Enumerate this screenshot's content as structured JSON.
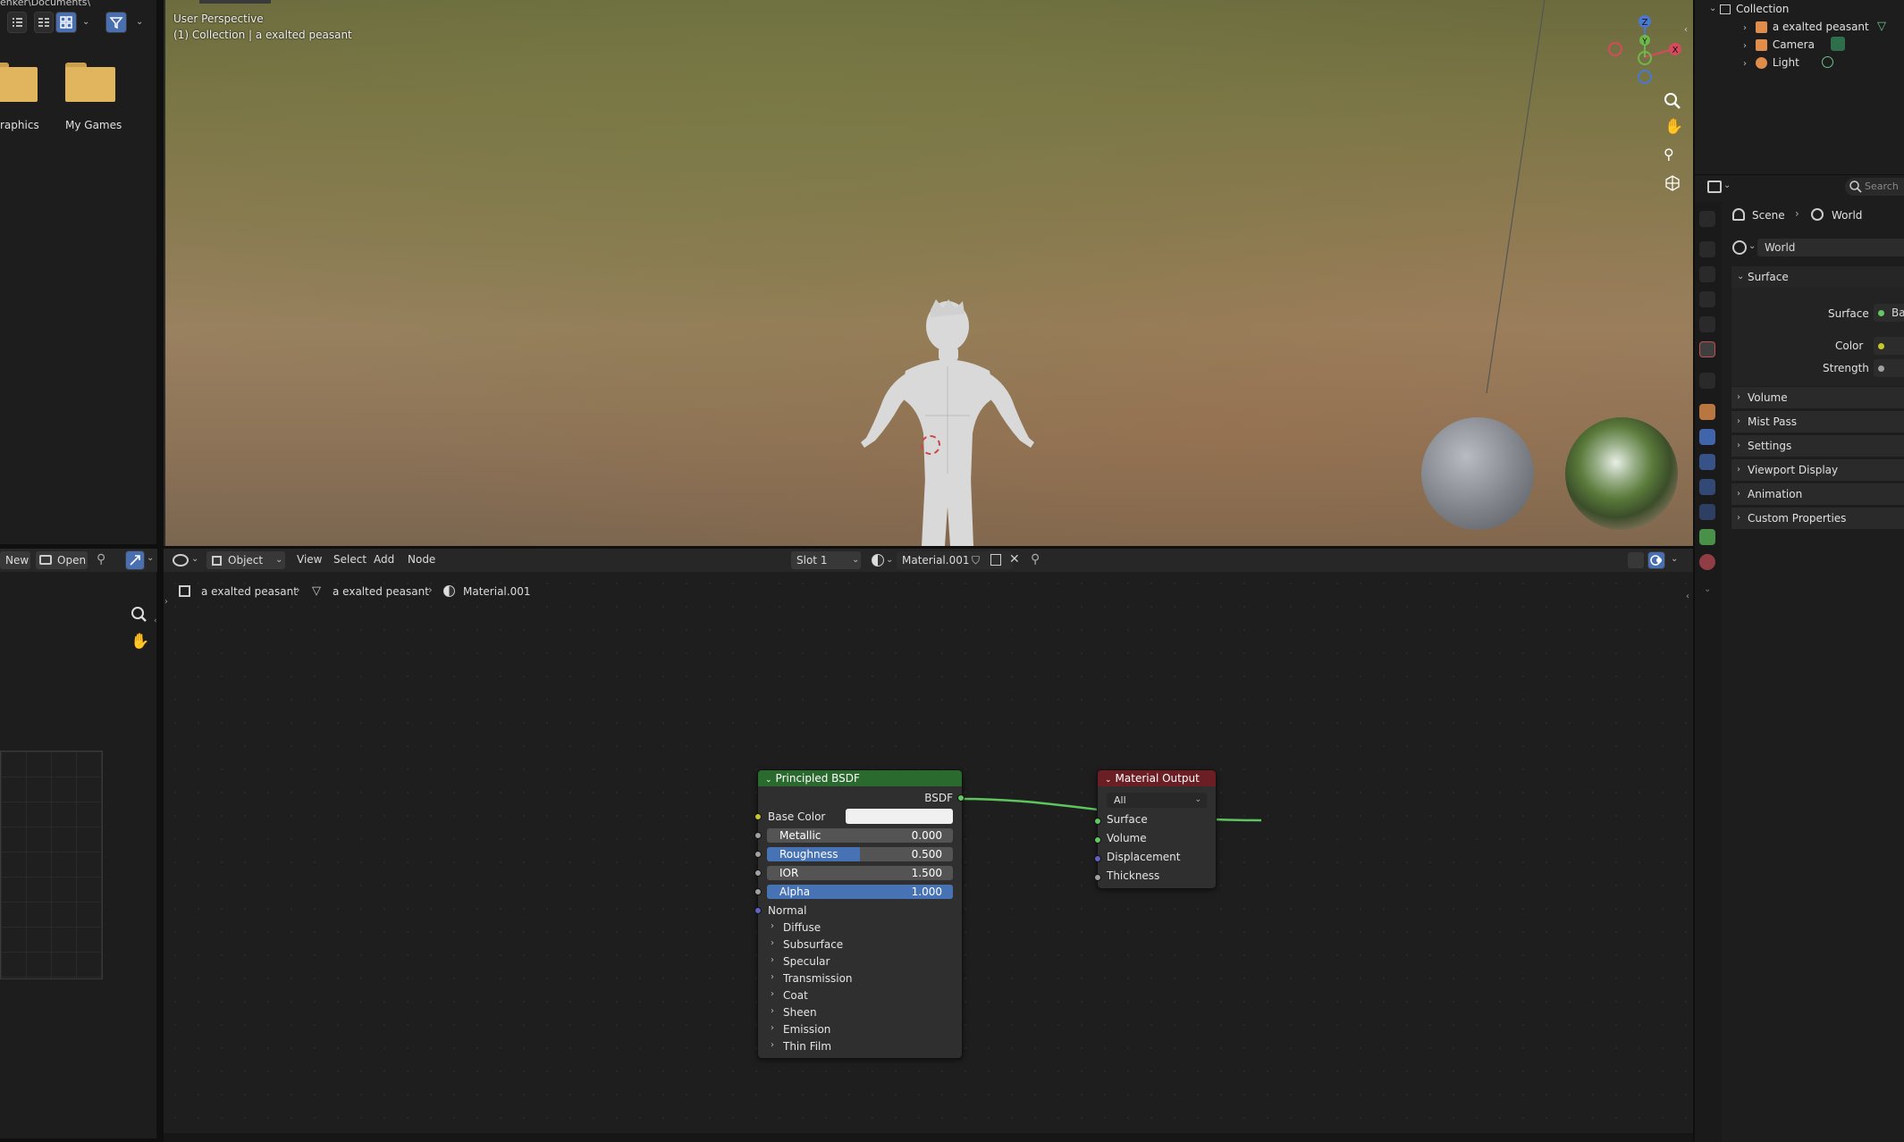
{
  "file_browser": {
    "path": "enker\\Documents\\",
    "folders": [
      {
        "label": "raphics"
      },
      {
        "label": "My Games"
      }
    ]
  },
  "left_lower": {
    "new_label": "New",
    "open_label": "Open"
  },
  "viewport": {
    "perspective_label": "User Perspective",
    "collection_label": "(1) Collection | a exalted peasant",
    "gizmo_axes": {
      "z": "Z",
      "y": "Y",
      "x": "X"
    }
  },
  "node_editor": {
    "mode": "Object",
    "menus": [
      "View",
      "Select",
      "Add",
      "Node"
    ],
    "slot": "Slot 1",
    "material_name": "Material.001",
    "breadcrumb": [
      "a exalted peasant",
      "a exalted peasant",
      "Material.001"
    ],
    "principled": {
      "title": "Principled BSDF",
      "output": "BSDF",
      "base_color_label": "Base Color",
      "sliders": [
        {
          "label": "Metallic",
          "value": "0.000",
          "fill": 0.0
        },
        {
          "label": "Roughness",
          "value": "0.500",
          "fill": 0.5
        },
        {
          "label": "IOR",
          "value": "1.500",
          "fill": 0.0
        },
        {
          "label": "Alpha",
          "value": "1.000",
          "fill": 1.0
        }
      ],
      "normal_label": "Normal",
      "panels": [
        "Diffuse",
        "Subsurface",
        "Specular",
        "Transmission",
        "Coat",
        "Sheen",
        "Emission",
        "Thin Film"
      ]
    },
    "material_output": {
      "title": "Material Output",
      "target": "All",
      "inputs": [
        "Surface",
        "Volume",
        "Displacement",
        "Thickness"
      ]
    }
  },
  "outliner": {
    "collection": "Collection",
    "items": [
      "a exalted peasant",
      "Camera",
      "Light"
    ]
  },
  "properties": {
    "search_placeholder": "Search",
    "breadcrumb_scene": "Scene",
    "breadcrumb_world": "World",
    "world_name": "World",
    "surface_panel": "Surface",
    "surface_label": "Surface",
    "surface_value": "Ba",
    "color_label": "Color",
    "strength_label": "Strength",
    "sections": [
      "Volume",
      "Mist Pass",
      "Settings",
      "Viewport Display",
      "Animation",
      "Custom Properties"
    ]
  },
  "colors": {
    "node_green_header": "#2b6a2e",
    "node_red_header": "#6b1f24",
    "accent_blue": "#4772b3",
    "socket_yellow": "#c7c729",
    "socket_grey": "#a1a1a1",
    "socket_purple": "#6363c7",
    "socket_green": "#63c763"
  }
}
